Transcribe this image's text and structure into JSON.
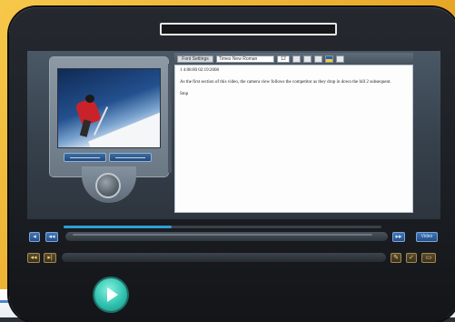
{
  "editor": {
    "toolbar": {
      "button_label": "Font Settings",
      "font_select": "Times New Roman",
      "size_select": "12"
    },
    "content": {
      "line1": "1 4:08:00 02:19:2008",
      "line2": "As the first section of this video, the camera view follows the competitor as they drop in down the hill 2 subsequent.",
      "line3": "Stop"
    }
  },
  "transport": {
    "progress_percent": 0.34,
    "time_label": "Video"
  },
  "colors": {
    "accent_blue": "#2f9fd8",
    "gold_background": "#f6c84a",
    "play_green": "#2fc3b0"
  }
}
